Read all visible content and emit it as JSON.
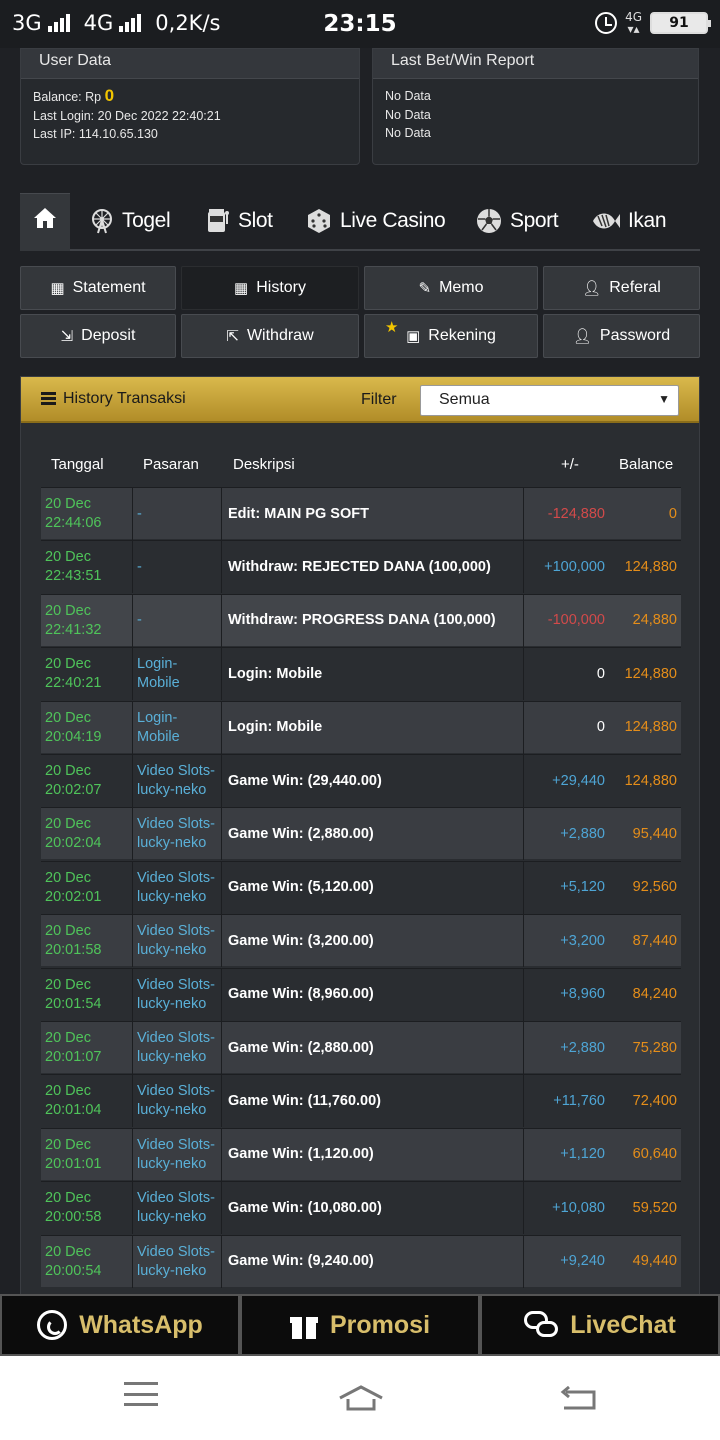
{
  "status_bar": {
    "left": "3G",
    "network2": "4G",
    "speed": "0,2K/s",
    "time": "23:15",
    "net_small": "4G",
    "battery": "91"
  },
  "user_data": {
    "title": "User Data",
    "balance_label": "Balance: Rp",
    "balance_value": "0",
    "last_login": "Last Login: 20 Dec 2022 22:40:21",
    "last_ip": "Last IP: 114.10.65.130"
  },
  "last_report": {
    "title": "Last Bet/Win Report",
    "lines": [
      "No Data",
      "No Data",
      "No Data"
    ]
  },
  "nav": {
    "items": [
      "Togel",
      "Slot",
      "Live Casino",
      "Sport",
      "Ikan"
    ]
  },
  "buttons": {
    "statement": "Statement",
    "history": "History",
    "memo": "Memo",
    "referal": "Referal",
    "deposit": "Deposit",
    "withdraw": "Withdraw",
    "rekening": "Rekening",
    "password": "Password"
  },
  "history": {
    "title": "History Transaksi",
    "filter_label": "Filter",
    "filter_value": "Semua",
    "headers": [
      "Tanggal",
      "Pasaran",
      "Deskripsi",
      "+/-",
      "Balance"
    ],
    "rows": [
      {
        "date": "20 Dec",
        "time": "22:44:06",
        "market": "-",
        "market2": "",
        "desc": "Edit: MAIN PG SOFT",
        "amount": "-124,880",
        "sign": "neg",
        "balance": "0"
      },
      {
        "date": "20 Dec",
        "time": "22:43:51",
        "market": "-",
        "market2": "",
        "desc": "Withdraw: REJECTED DANA (100,000)",
        "amount": "+100,000",
        "sign": "pos",
        "balance": "124,880"
      },
      {
        "date": "20 Dec",
        "time": "22:41:32",
        "market": "-",
        "market2": "",
        "desc": "Withdraw: PROGRESS DANA (100,000)",
        "amount": "-100,000",
        "sign": "neg",
        "balance": "24,880"
      },
      {
        "date": "20 Dec",
        "time": "22:40:21",
        "market": "Login-Mobile",
        "market2": "",
        "desc": "Login: Mobile",
        "amount": "0",
        "sign": "zero",
        "balance": "124,880"
      },
      {
        "date": "20 Dec",
        "time": "20:04:19",
        "market": "Login-Mobile",
        "market2": "",
        "desc": "Login: Mobile",
        "amount": "0",
        "sign": "zero",
        "balance": "124,880"
      },
      {
        "date": "20 Dec",
        "time": "20:02:07",
        "market": "Video Slots-",
        "market2": "lucky-neko",
        "desc": "Game Win: (29,440.00)",
        "amount": "+29,440",
        "sign": "pos",
        "balance": "124,880"
      },
      {
        "date": "20 Dec",
        "time": "20:02:04",
        "market": "Video Slots-",
        "market2": "lucky-neko",
        "desc": "Game Win: (2,880.00)",
        "amount": "+2,880",
        "sign": "pos",
        "balance": "95,440"
      },
      {
        "date": "20 Dec",
        "time": "20:02:01",
        "market": "Video Slots-",
        "market2": "lucky-neko",
        "desc": "Game Win: (5,120.00)",
        "amount": "+5,120",
        "sign": "pos",
        "balance": "92,560"
      },
      {
        "date": "20 Dec",
        "time": "20:01:58",
        "market": "Video Slots-",
        "market2": "lucky-neko",
        "desc": "Game Win: (3,200.00)",
        "amount": "+3,200",
        "sign": "pos",
        "balance": "87,440"
      },
      {
        "date": "20 Dec",
        "time": "20:01:54",
        "market": "Video Slots-",
        "market2": "lucky-neko",
        "desc": "Game Win: (8,960.00)",
        "amount": "+8,960",
        "sign": "pos",
        "balance": "84,240"
      },
      {
        "date": "20 Dec",
        "time": "20:01:07",
        "market": "Video Slots-",
        "market2": "lucky-neko",
        "desc": "Game Win: (2,880.00)",
        "amount": "+2,880",
        "sign": "pos",
        "balance": "75,280"
      },
      {
        "date": "20 Dec",
        "time": "20:01:04",
        "market": "Video Slots-",
        "market2": "lucky-neko",
        "desc": "Game Win: (11,760.00)",
        "amount": "+11,760",
        "sign": "pos",
        "balance": "72,400"
      },
      {
        "date": "20 Dec",
        "time": "20:01:01",
        "market": "Video Slots-",
        "market2": "lucky-neko",
        "desc": "Game Win: (1,120.00)",
        "amount": "+1,120",
        "sign": "pos",
        "balance": "60,640"
      },
      {
        "date": "20 Dec",
        "time": "20:00:58",
        "market": "Video Slots-",
        "market2": "lucky-neko",
        "desc": "Game Win: (10,080.00)",
        "amount": "+10,080",
        "sign": "pos",
        "balance": "59,520"
      },
      {
        "date": "20 Dec",
        "time": "20:00:54",
        "market": "Video Slots-",
        "market2": "lucky-neko",
        "desc": "Game Win: (9,240.00)",
        "amount": "+9,240",
        "sign": "pos",
        "balance": "49,440"
      }
    ]
  },
  "footer": {
    "whatsapp": "WhatsApp",
    "promosi": "Promosi",
    "livechat": "LiveChat"
  },
  "colors": {
    "gold": "#d8be6b",
    "green_date": "#4fc45a",
    "blue_link": "#5ab0d8",
    "neg": "#d24a4a",
    "pos": "#4ea5d5",
    "balance": "#e58e1a"
  }
}
